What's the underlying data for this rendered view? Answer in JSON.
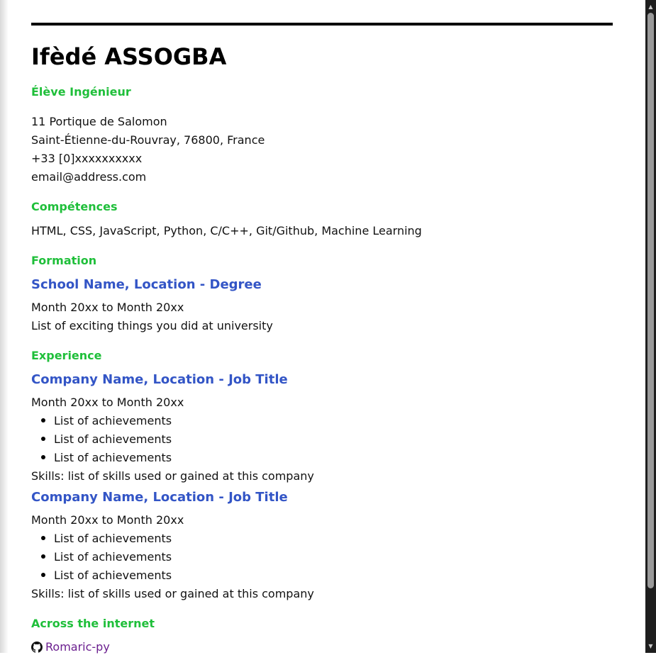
{
  "header": {
    "name": "Ifèdé ASSOGBA",
    "role": "Élève Ingénieur"
  },
  "contact": {
    "address_line1": "11 Portique de Salomon",
    "address_line2": "Saint-Étienne-du-Rouvray, 76800, France",
    "phone": "+33 [0]xxxxxxxxxx",
    "email": "email@address.com"
  },
  "skills": {
    "heading": "Compétences",
    "text": "HTML, CSS, JavaScript, Python, C/C++, Git/Github, Machine Learning"
  },
  "education": {
    "heading": "Formation",
    "entries": [
      {
        "title": "School Name, Location - Degree",
        "dates": "Month 20xx to Month 20xx",
        "description": "List of exciting things you did at university"
      }
    ]
  },
  "experience": {
    "heading": "Experience",
    "entries": [
      {
        "title": "Company Name, Location - Job Title",
        "dates": "Month 20xx to Month 20xx",
        "achievements": [
          "List of achievements",
          "List of achievements",
          "List of achievements"
        ],
        "skills": "Skills: list of skills used or gained at this company"
      },
      {
        "title": "Company Name, Location - Job Title",
        "dates": "Month 20xx to Month 20xx",
        "achievements": [
          "List of achievements",
          "List of achievements",
          "List of achievements"
        ],
        "skills": "Skills: list of skills used or gained at this company"
      }
    ]
  },
  "internet": {
    "heading": "Across the internet",
    "links": [
      {
        "icon": "github-icon",
        "label": "Romaric-py"
      }
    ]
  },
  "colors": {
    "section_heading": "#1fbf3a",
    "entry_title": "#3355c6",
    "link": "#6b1f8f"
  }
}
